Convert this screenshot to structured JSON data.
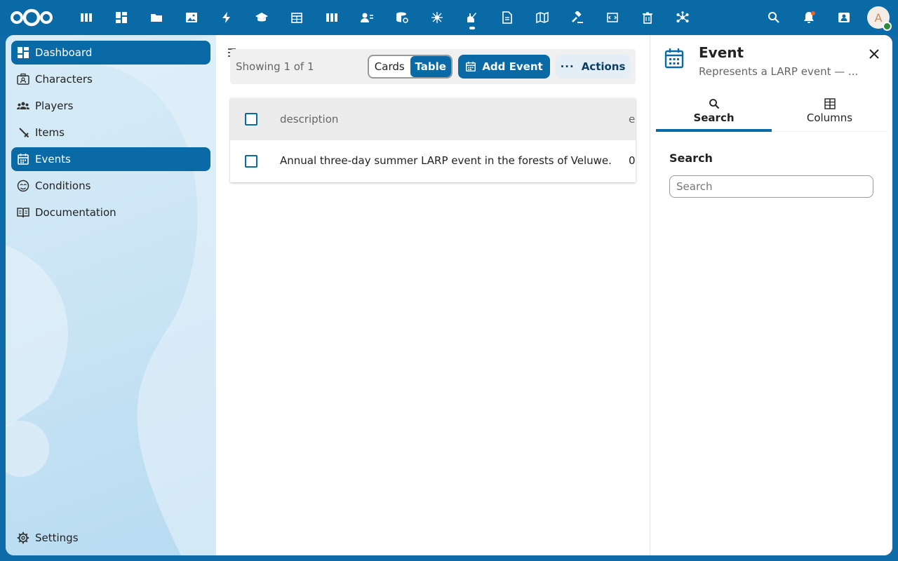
{
  "header": {
    "apps": [
      {
        "icon": "dashboard-icon"
      },
      {
        "icon": "grid-icon"
      },
      {
        "icon": "files-icon"
      },
      {
        "icon": "photos-icon"
      },
      {
        "icon": "activity-icon"
      },
      {
        "icon": "learn-icon"
      },
      {
        "icon": "calendar-icon"
      },
      {
        "icon": "deck-icon"
      },
      {
        "icon": "contacts-icon"
      },
      {
        "icon": "database-icon"
      },
      {
        "icon": "spider-icon"
      },
      {
        "icon": "larp-icon"
      },
      {
        "icon": "document-icon"
      },
      {
        "icon": "map-icon"
      },
      {
        "icon": "gavel-icon"
      },
      {
        "icon": "code-icon"
      },
      {
        "icon": "trash-icon"
      },
      {
        "icon": "network-icon"
      }
    ],
    "active_app_index": 11,
    "avatar_letter": "A"
  },
  "sidebar": {
    "items": [
      {
        "label": "Dashboard",
        "icon": "dashboard-icon",
        "active": true
      },
      {
        "label": "Characters",
        "icon": "character-icon",
        "active": false
      },
      {
        "label": "Players",
        "icon": "players-icon",
        "active": false
      },
      {
        "label": "Items",
        "icon": "sword-icon",
        "active": false
      },
      {
        "label": "Events",
        "icon": "calendar-icon",
        "active": true
      },
      {
        "label": "Conditions",
        "icon": "conditions-icon",
        "active": false
      },
      {
        "label": "Documentation",
        "icon": "book-icon",
        "active": false
      }
    ],
    "settings_label": "Settings"
  },
  "toolbar": {
    "showing": "Showing 1 of 1",
    "cards_label": "Cards",
    "table_label": "Table",
    "add_label": "Add Event",
    "actions_label": "Actions"
  },
  "table": {
    "columns": [
      "description",
      "e"
    ],
    "rows": [
      {
        "description": "Annual three-day summer LARP event in the forests of Veluwe.",
        "e": "0"
      }
    ]
  },
  "panel": {
    "title": "Event",
    "subtitle": "Represents a LARP event — ...",
    "tabs": [
      {
        "label": "Search",
        "icon": "search-icon",
        "active": true
      },
      {
        "label": "Columns",
        "icon": "columns-icon",
        "active": false
      }
    ],
    "search_label": "Search",
    "search_placeholder": "Search",
    "search_value": ""
  },
  "colors": {
    "primary": "#0a6aa5",
    "header_bg": "#0a6aa5",
    "notification": "#e9652a",
    "status_online": "#2d8a3e"
  }
}
